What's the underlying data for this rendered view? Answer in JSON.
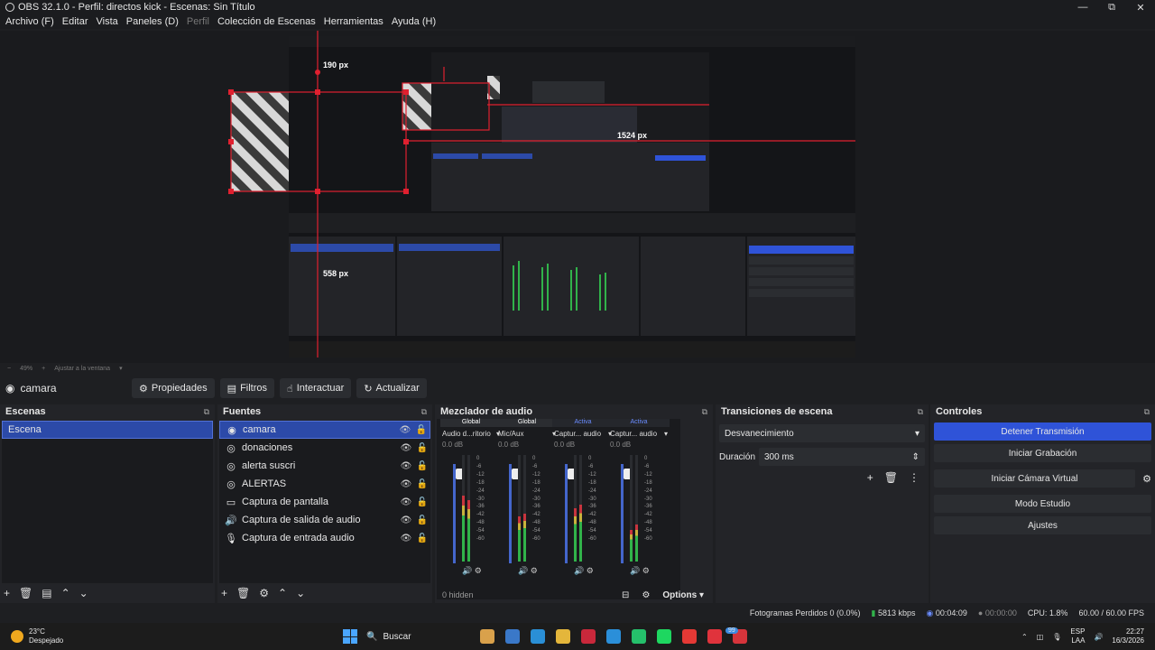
{
  "window": {
    "title": "OBS 32.1.0 - Perfil: directos kick - Escenas: Sin Título",
    "controls": {
      "minimize": "—",
      "maximize": "⧉",
      "close": "✕"
    }
  },
  "menu": {
    "items": [
      "Archivo (F)",
      "Editar",
      "Vista",
      "Paneles (D)",
      "Perfil",
      "Colección de Escenas",
      "Herramientas",
      "Ayuda (H)"
    ]
  },
  "preview": {
    "measure_top": "190 px",
    "measure_right": "1524 px",
    "measure_left": "558 px",
    "zoom": "49%",
    "zoom_mode": "Ajustar a la ventana"
  },
  "source_toolbar": {
    "current_source": "camara",
    "buttons": {
      "properties": "Propiedades",
      "filters": "Filtros",
      "interact": "Interactuar",
      "refresh": "Actualizar"
    }
  },
  "scenes": {
    "title": "Escenas",
    "items": [
      "Escena"
    ]
  },
  "sources": {
    "title": "Fuentes",
    "items": [
      {
        "icon": "camera-icon",
        "label": "camara"
      },
      {
        "icon": "browser-icon",
        "label": "donaciones"
      },
      {
        "icon": "browser-icon",
        "label": "alerta suscri"
      },
      {
        "icon": "browser-icon",
        "label": "ALERTAS"
      },
      {
        "icon": "monitor-icon",
        "label": "Captura de pantalla"
      },
      {
        "icon": "speaker-icon",
        "label": "Captura de salida de audio"
      },
      {
        "icon": "mic-icon",
        "label": "Captura de entrada audio"
      }
    ]
  },
  "mixer": {
    "title": "Mezclador de audio",
    "hidden": "0 hidden",
    "options": "Options",
    "scale": [
      "0",
      "-6",
      "-12",
      "-18",
      "-24",
      "-30",
      "-36",
      "-42",
      "-48",
      "-54",
      "-60"
    ],
    "channels": [
      {
        "tag": "Global",
        "tag_style": "global",
        "name": "Audio d...ritorio",
        "db": "0.0 dB",
        "fader_level": 0.95,
        "meter_l": 0.62,
        "meter_r": 0.58
      },
      {
        "tag": "Global",
        "tag_style": "global",
        "name": "Mic/Aux",
        "db": "0.0 dB",
        "fader_level": 0.95,
        "meter_l": 0.42,
        "meter_r": 0.45
      },
      {
        "tag": "Activa",
        "tag_style": "active",
        "name": "Captur... audio",
        "db": "0.0 dB",
        "fader_level": 0.95,
        "meter_l": 0.5,
        "meter_r": 0.53
      },
      {
        "tag": "Activa",
        "tag_style": "active",
        "name": "Captur... audio",
        "db": "0.0 dB",
        "fader_level": 0.95,
        "meter_l": 0.3,
        "meter_r": 0.35
      }
    ]
  },
  "transitions": {
    "title": "Transiciones de escena",
    "selected": "Desvanecimiento",
    "duration_label": "Duración",
    "duration_value": "300 ms"
  },
  "controls": {
    "title": "Controles",
    "stop_stream": "Detener Transmisión",
    "start_recording": "Iniciar Grabación",
    "start_virtual_cam": "Iniciar Cámara Virtual",
    "studio_mode": "Modo Estudio",
    "settings": "Ajustes"
  },
  "status": {
    "dropped_frames": "Fotogramas Perdidos 0 (0.0%)",
    "bitrate": "5813 kbps",
    "stream_time": "00:04:09",
    "rec_time": "00:00:00",
    "cpu": "CPU: 1.8%",
    "fps": "60.00 / 60.00 FPS"
  },
  "taskbar": {
    "temperature": "23°C",
    "weather": "Despejado",
    "search": "Buscar",
    "lang1": "ESP",
    "lang2": "LAA",
    "time": "22:27",
    "date": "16/3/2026",
    "badge": "99",
    "icon_colors": [
      "#d9a14b",
      "#3a78c8",
      "#2a8fd6",
      "#e4b63b",
      "#c9283b",
      "#2b8fd9",
      "#25c06b",
      "#1ed760",
      "#e53935",
      "#e0333c",
      "#d6343b"
    ]
  },
  "colors": {
    "accent": "#2f53d8",
    "selection": "#2c4aa8",
    "measure_red": "#e0202f"
  }
}
